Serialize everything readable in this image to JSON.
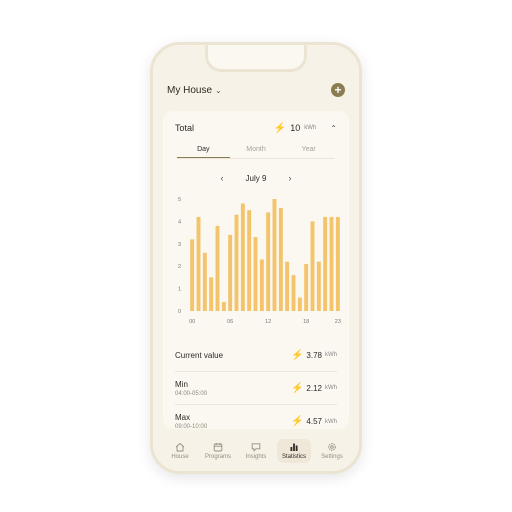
{
  "header": {
    "house_label": "My House"
  },
  "total": {
    "label": "Total",
    "value": "10",
    "unit": "kWh"
  },
  "tabs": [
    {
      "label": "Day",
      "active": true
    },
    {
      "label": "Month",
      "active": false
    },
    {
      "label": "Year",
      "active": false
    }
  ],
  "date": {
    "label": "July 9",
    "prev": "‹",
    "next": "›"
  },
  "chart_data": {
    "type": "bar",
    "x": [
      0,
      1,
      2,
      3,
      4,
      5,
      6,
      7,
      8,
      9,
      10,
      11,
      12,
      13,
      14,
      15,
      16,
      17,
      18,
      19,
      20,
      21,
      22,
      23
    ],
    "values": [
      3.2,
      4.2,
      2.6,
      1.5,
      3.8,
      0.4,
      3.4,
      4.3,
      4.8,
      4.5,
      3.3,
      2.3,
      4.4,
      5.0,
      4.6,
      2.2,
      1.6,
      0.6,
      2.1,
      4.0,
      2.2,
      4.2,
      4.2,
      4.2
    ],
    "xticks": [
      "00",
      "06",
      "12",
      "18",
      "23"
    ],
    "yticks": [
      "0",
      "1",
      "2",
      "3",
      "4",
      "5"
    ],
    "ylim": [
      0,
      5
    ],
    "color": "#f3c46c"
  },
  "stats": [
    {
      "title": "Current value",
      "sub": "",
      "value": "3.78",
      "unit": "kWh"
    },
    {
      "title": "Min",
      "sub": "04:00-05:00",
      "value": "2.12",
      "unit": "kWh"
    },
    {
      "title": "Max",
      "sub": "09:00-10:00",
      "value": "4.57",
      "unit": "kWh"
    }
  ],
  "tabbar": [
    {
      "label": "House",
      "icon": "house-icon",
      "active": false
    },
    {
      "label": "Programs",
      "icon": "calendar-icon",
      "active": false
    },
    {
      "label": "Insights",
      "icon": "chat-icon",
      "active": false
    },
    {
      "label": "Statistics",
      "icon": "bar-chart-icon",
      "active": true
    },
    {
      "label": "Settings",
      "icon": "gear-icon",
      "active": false
    }
  ]
}
